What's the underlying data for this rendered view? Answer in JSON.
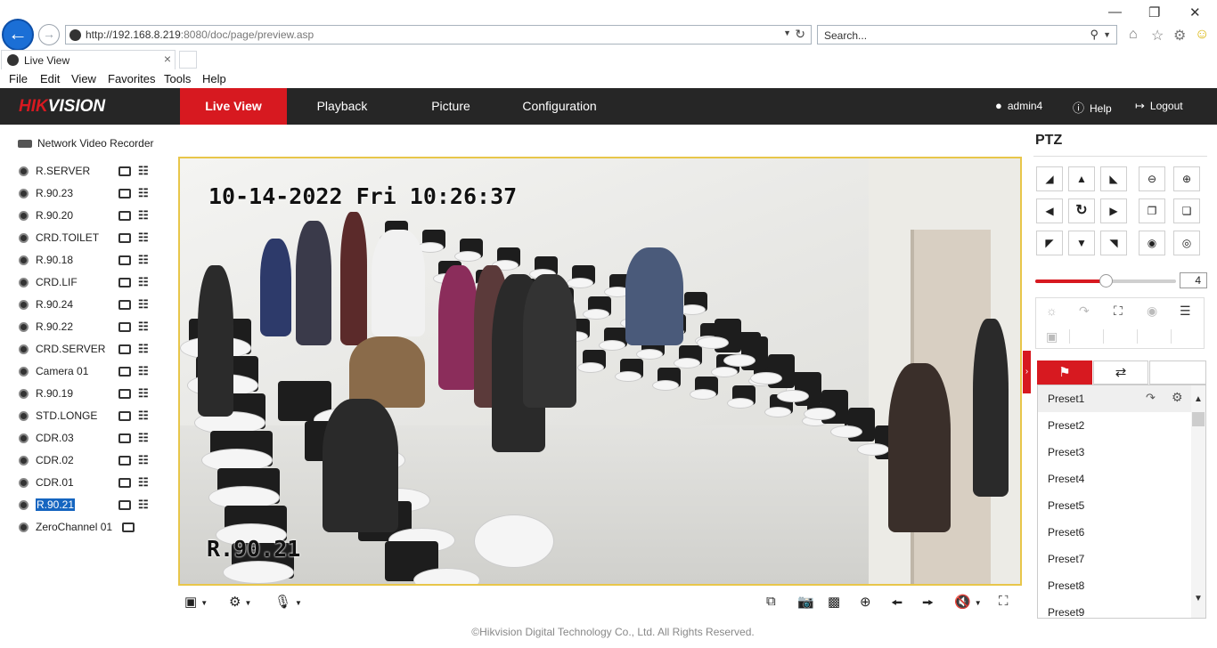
{
  "browser": {
    "url_main": "http://192.168.8.219",
    "url_rest": ":8080/doc/page/preview.asp",
    "search_placeholder": "Search...",
    "tab_title": "Live View",
    "menu": [
      "File",
      "Edit",
      "View",
      "Favorites",
      "Tools",
      "Help"
    ]
  },
  "header": {
    "logo_red": "HIK",
    "logo_white": "VISION",
    "nav": [
      "Live View",
      "Playback",
      "Picture",
      "Configuration"
    ],
    "active_nav": "Live View",
    "user": "admin4",
    "help": "Help",
    "logout": "Logout"
  },
  "tree": {
    "root": "Network Video Recorder",
    "cameras": [
      "R.SERVER",
      "R.90.23",
      "R.90.20",
      "CRD.TOILET",
      "R.90.18",
      "CRD.LIF",
      "R.90.24",
      "R.90.22",
      "CRD.SERVER",
      "Camera 01",
      "R.90.19",
      "STD.LONGE",
      "CDR.03",
      "CDR.02",
      "CDR.01",
      "R.90.21",
      "ZeroChannel 01"
    ],
    "selected": "R.90.21"
  },
  "video": {
    "timestamp": "10-14-2022 Fri 10:26:37",
    "channel_label": "R.90.21"
  },
  "ptz": {
    "title": "PTZ",
    "speed": "4",
    "speed_fraction": 0.5,
    "presets": [
      "Preset1",
      "Preset2",
      "Preset3",
      "Preset4",
      "Preset5",
      "Preset6",
      "Preset7",
      "Preset8",
      "Preset9"
    ]
  },
  "footer": "©Hikvision Digital Technology Co., Ltd. All Rights Reserved.",
  "colors": {
    "brand_red": "#d71920",
    "header_bg": "#262626",
    "selection_blue": "#1565c0",
    "video_border": "#e8c64a"
  }
}
